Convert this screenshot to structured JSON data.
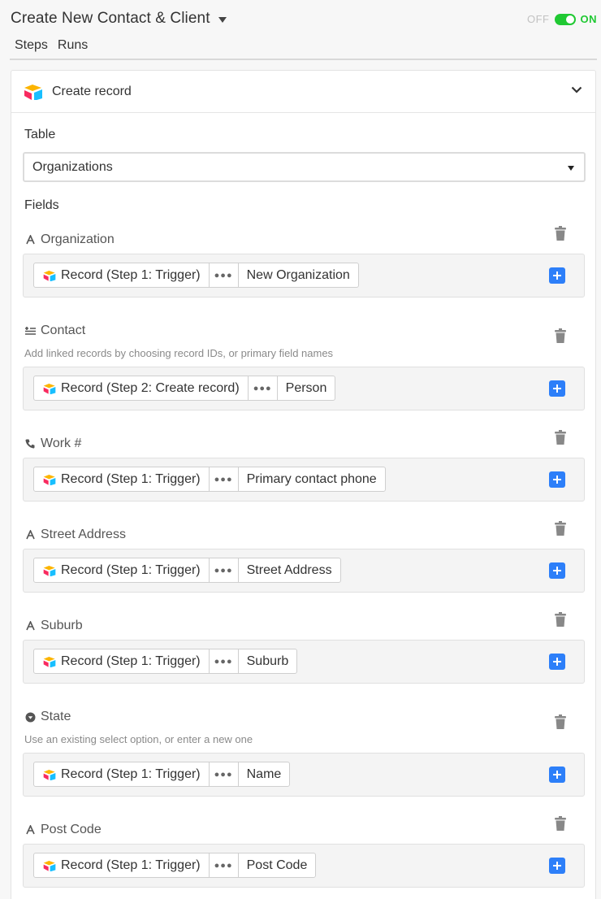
{
  "header": {
    "title": "Create New Contact & Client",
    "toggle_off": "OFF",
    "toggle_on": "ON"
  },
  "tabs": [
    {
      "label": "Steps",
      "active": true
    },
    {
      "label": "Runs",
      "active": false
    }
  ],
  "step": {
    "title": "Create record",
    "table_label": "Table",
    "table_value": "Organizations",
    "fields_label": "Fields"
  },
  "fields": [
    {
      "name": "Organization",
      "icon": "text-icon",
      "help": "",
      "source": "Record (Step 1: Trigger)",
      "value": "New Organization"
    },
    {
      "name": "Contact",
      "icon": "link-icon",
      "help": "Add linked records by choosing record IDs, or primary field names",
      "source": "Record (Step 2: Create record)",
      "value": "Person"
    },
    {
      "name": "Work #",
      "icon": "phone-icon",
      "help": "",
      "source": "Record (Step 1: Trigger)",
      "value": "Primary contact phone"
    },
    {
      "name": "Street Address",
      "icon": "text-icon",
      "help": "",
      "source": "Record (Step 1: Trigger)",
      "value": "Street Address"
    },
    {
      "name": "Suburb",
      "icon": "text-icon",
      "help": "",
      "source": "Record (Step 1: Trigger)",
      "value": "Suburb"
    },
    {
      "name": "State",
      "icon": "select-icon",
      "help": "Use an existing select option, or enter a new one",
      "source": "Record (Step 1: Trigger)",
      "value": "Name"
    },
    {
      "name": "Post Code",
      "icon": "text-icon",
      "help": "",
      "source": "Record (Step 1: Trigger)",
      "value": "Post Code"
    }
  ],
  "colors": {
    "accent": "#2d7ff9",
    "toggle_on": "#20c933"
  }
}
